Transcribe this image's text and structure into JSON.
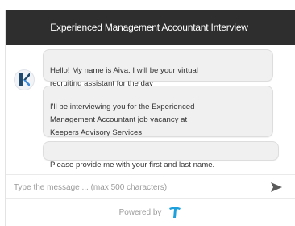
{
  "header": {
    "title": "Experienced Management Accountant Interview"
  },
  "avatar": {
    "icon": "keepers-k-logo-icon",
    "colors": {
      "dark": "#1f4a6e",
      "light": "#3f8ad8"
    }
  },
  "messages": [
    {
      "text": "Hello! My name is Aiva. I will be your virtual\nrecruiting assistant for the day",
      "emoji": "smiley-emoji-icon"
    },
    {
      "text": "I'll be interviewing you for the Experienced\nManagement Accountant job vacancy at\nKeepers Advisory Services."
    },
    {
      "text": "Please provide me with your first and last name."
    }
  ],
  "input": {
    "placeholder": "Type the message ... (max 500 characters)",
    "value": ""
  },
  "send": {
    "icon": "send-arrow-icon",
    "color": "#5a5a5a"
  },
  "footer": {
    "label": "Powered by",
    "logo_icon": "brand-t-logo-icon",
    "logo_color": "#1ea0dc"
  },
  "colors": {
    "header_bg": "#2e2e2e",
    "bubble_bg": "#f0f0f0"
  }
}
